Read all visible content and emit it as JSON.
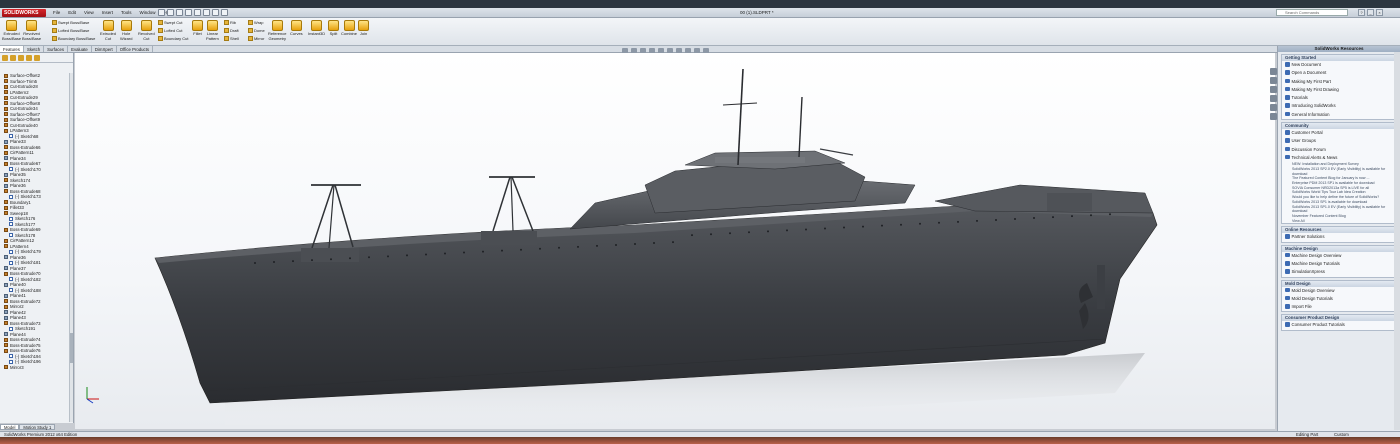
{
  "app": {
    "logo": "SOLIDWORKS",
    "doc_title": "00 (1).SLDPRT *",
    "status": "SolidWorks Premium 2012 x64 Edition",
    "status_mode": "Editing Part",
    "status_units": "Custom"
  },
  "menu": [
    "File",
    "Edit",
    "View",
    "Insert",
    "Tools",
    "Window",
    "Help"
  ],
  "search": {
    "placeholder": "Search Commands"
  },
  "ribbon": {
    "big": [
      {
        "label": "Extruded\nBoss/Base"
      },
      {
        "label": "Revolved\nBoss/Base"
      },
      {
        "label": "Extruded\nCut"
      },
      {
        "label": "Hole\nWizard"
      },
      {
        "label": "Revolved\nCut"
      },
      {
        "label": "Fillet"
      },
      {
        "label": "Linear\nPattern"
      },
      {
        "label": "Reference\nGeometry"
      },
      {
        "label": "Curves"
      },
      {
        "label": "Instant3D"
      },
      {
        "label": "Split"
      },
      {
        "label": "Combine"
      },
      {
        "label": "Join"
      }
    ],
    "small_a": [
      "Swept Boss/Base",
      "Lofted Boss/Base",
      "Boundary Boss/Base"
    ],
    "small_b": [
      "Swept Cut",
      "Lofted Cut",
      "Boundary Cut"
    ],
    "small_c": [
      "Rib",
      "Draft",
      "Shell"
    ],
    "small_d": [
      "Wrap",
      "Dome",
      "Mirror"
    ]
  },
  "cmd_tabs": [
    "Features",
    "Sketch",
    "Surfaces",
    "Evaluate",
    "DimXpert",
    "Office Products"
  ],
  "tree": [
    {
      "label": "Surface-Offset2",
      "kind": "feat"
    },
    {
      "label": "Surface-Trim5",
      "kind": "feat"
    },
    {
      "label": "Cut-Extrude28",
      "kind": "feat"
    },
    {
      "label": "LPattern2",
      "kind": "feat"
    },
    {
      "label": "Cut-Extrude29",
      "kind": "feat"
    },
    {
      "label": "Surface-Offset8",
      "kind": "feat"
    },
    {
      "label": "Cut-Extrude34",
      "kind": "feat"
    },
    {
      "label": "Surface-Offset7",
      "kind": "feat"
    },
    {
      "label": "Surface-Offset9",
      "kind": "feat"
    },
    {
      "label": "Cut-Extrude40",
      "kind": "feat"
    },
    {
      "label": "LPattern3",
      "kind": "feat"
    },
    {
      "label": "(-) Sketch68",
      "kind": "sketch"
    },
    {
      "label": "Plane33",
      "kind": "plane"
    },
    {
      "label": "Boss-Extrude66",
      "kind": "feat"
    },
    {
      "label": "CirPattern11",
      "kind": "feat"
    },
    {
      "label": "Plane34",
      "kind": "plane"
    },
    {
      "label": "Boss-Extrude67",
      "kind": "feat"
    },
    {
      "label": "(-) Sketch170",
      "kind": "sketch"
    },
    {
      "label": "Plane35",
      "kind": "plane"
    },
    {
      "label": "Sketch174",
      "kind": "feat"
    },
    {
      "label": "Plane36",
      "kind": "plane"
    },
    {
      "label": "Boss-Extrude68",
      "kind": "feat"
    },
    {
      "label": "(-) Sketch173",
      "kind": "sketch"
    },
    {
      "label": "Boundary1",
      "kind": "feat"
    },
    {
      "label": "Fillet33",
      "kind": "feat"
    },
    {
      "label": "Sweep18",
      "kind": "feat"
    },
    {
      "label": "Sketch176",
      "kind": "sketch"
    },
    {
      "label": "Sketch177",
      "kind": "sketch"
    },
    {
      "label": "Boss-Extrude69",
      "kind": "feat"
    },
    {
      "label": "Sketch178",
      "kind": "sketch"
    },
    {
      "label": "CirPattern12",
      "kind": "feat"
    },
    {
      "label": "LPattern4",
      "kind": "feat"
    },
    {
      "label": "(-) Sketch179",
      "kind": "sketch"
    },
    {
      "label": "Plane36",
      "kind": "plane"
    },
    {
      "label": "(-) Sketch181",
      "kind": "sketch"
    },
    {
      "label": "Plane37",
      "kind": "plane"
    },
    {
      "label": "Boss-Extrude70",
      "kind": "feat"
    },
    {
      "label": "(-) Sketch182",
      "kind": "sketch"
    },
    {
      "label": "Plane40",
      "kind": "plane"
    },
    {
      "label": "(-) Sketch188",
      "kind": "sketch"
    },
    {
      "label": "Plane41",
      "kind": "plane"
    },
    {
      "label": "Boss-Extrude72",
      "kind": "feat"
    },
    {
      "label": "Mirror2",
      "kind": "feat"
    },
    {
      "label": "Plane42",
      "kind": "plane"
    },
    {
      "label": "Plane43",
      "kind": "plane"
    },
    {
      "label": "Boss-Extrude73",
      "kind": "feat"
    },
    {
      "label": "Sketch191",
      "kind": "sketch"
    },
    {
      "label": "Plane44",
      "kind": "plane"
    },
    {
      "label": "Boss-Extrude74",
      "kind": "feat"
    },
    {
      "label": "Boss-Extrude75",
      "kind": "feat"
    },
    {
      "label": "Boss-Extrude76",
      "kind": "feat"
    },
    {
      "label": "(-) Sketch194",
      "kind": "sketch"
    },
    {
      "label": "(-) Sketch196",
      "kind": "sketch"
    },
    {
      "label": "Mirror3",
      "kind": "feat"
    }
  ],
  "model_tabs": [
    "Model",
    "Motion Study 1"
  ],
  "taskpane": {
    "title": "SolidWorks Resources",
    "getting_started": {
      "title": "Getting Started",
      "links": [
        "New Document",
        "Open a Document",
        "Making My First Part",
        "Making My First Drawing",
        "Tutorials",
        "Introducing SolidWorks",
        "General Information"
      ]
    },
    "community": {
      "title": "Community",
      "links": [
        "Customer Portal",
        "User Groups",
        "Discussion Forum",
        "Technical Alerts & News"
      ],
      "news": [
        "NEW: Installation and Deployment Survey",
        "SolidWorks 2013 SP2.0 EV (Early Visibility) is available for download",
        "The Featured Content Blog for January is now ...",
        "Enterprise PDM 2013 SP1 is available for download",
        "SOVIA Consumer NRD2013a SP5 is LIVE for all",
        "SolidWorks World Tips Tour Lab Idea Creation",
        "Would you like to help define the future of SolidWorks?",
        "SolidWorks 2013 SP1 is available for download",
        "SolidWorks 2013 SP1.0 EV (Early Visibility) is available for download",
        "November Featured Content Blog"
      ],
      "view_all": "View All"
    },
    "online": {
      "title": "Online Resources",
      "links": [
        "Partner Solutions"
      ]
    },
    "machine": {
      "title": "Machine Design",
      "links": [
        "Machine Design Overview",
        "Machine Design Tutorials",
        "SimulationXpress"
      ]
    },
    "mold": {
      "title": "Mold Design",
      "links": [
        "Mold Design Overview",
        "Mold Design Tutorials",
        "Import File"
      ]
    },
    "consumer": {
      "title": "Consumer Product Design",
      "links": [
        "Consumer Product Tutorials"
      ]
    }
  },
  "colors": {
    "hull": "#3a3d42",
    "deck": "#4a4d52",
    "accent": "#d8262b"
  }
}
